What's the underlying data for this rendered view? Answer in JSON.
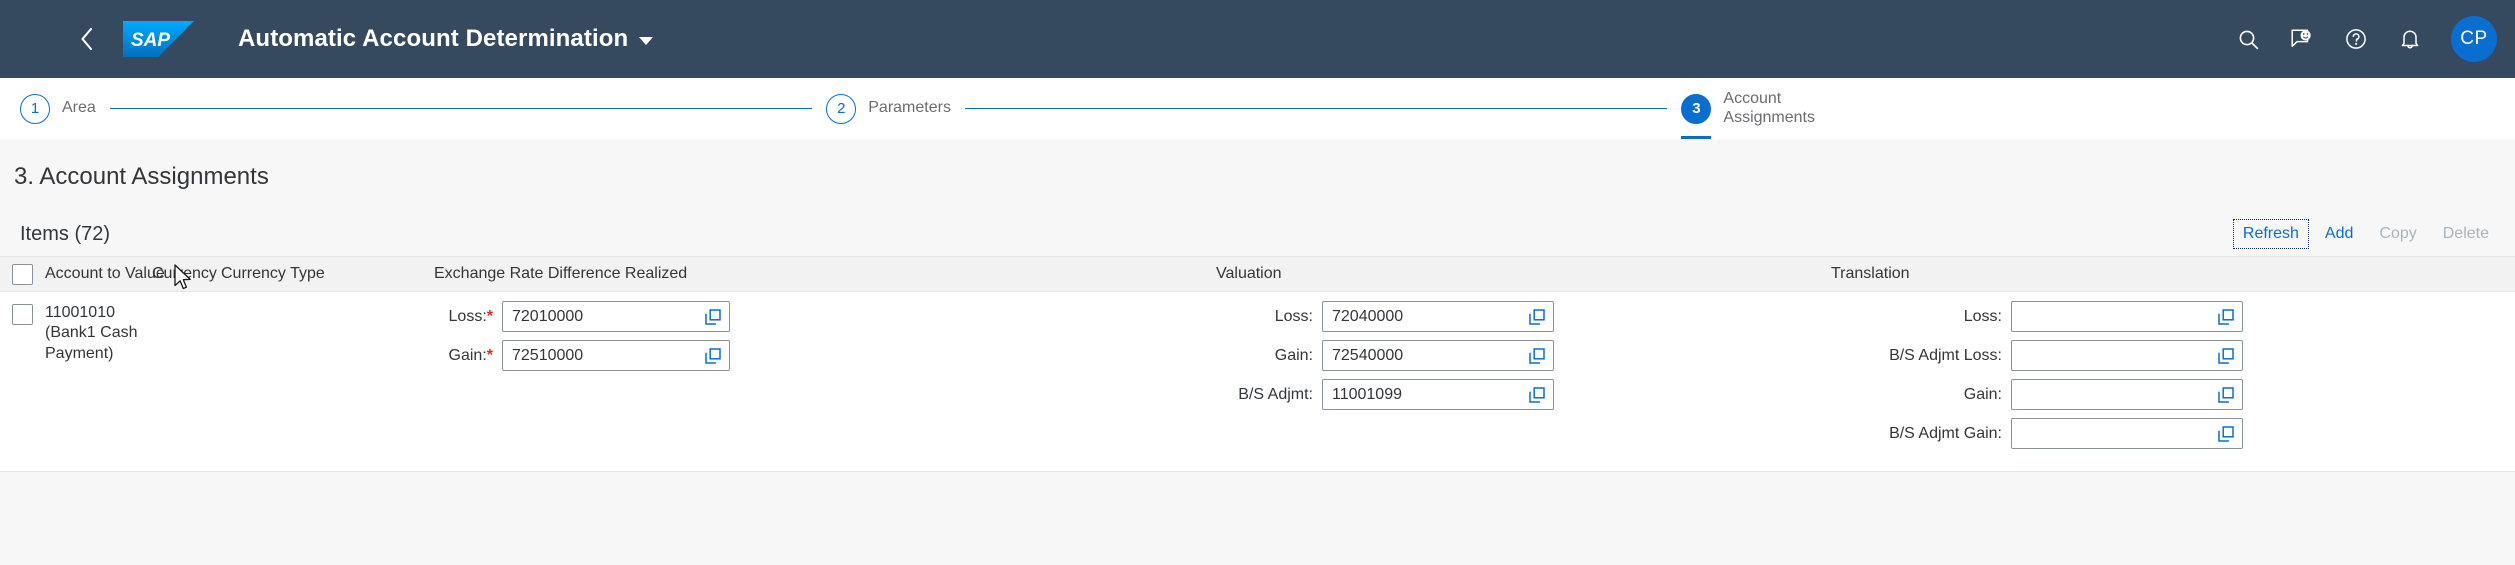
{
  "shell": {
    "back_icon": "chevron-left-icon",
    "logo_text": "SAP",
    "title": "Automatic Account Determination",
    "icons": [
      "search-icon",
      "feedback-icon",
      "help-icon",
      "notifications-icon"
    ],
    "avatar_initials": "CP"
  },
  "wizard": {
    "steps": [
      {
        "number": "1",
        "label": "Area",
        "state": "completed"
      },
      {
        "number": "2",
        "label": "Parameters",
        "state": "completed"
      },
      {
        "number": "3",
        "label": "Account\nAssignments",
        "state": "active"
      }
    ]
  },
  "page": {
    "title": "3. Account Assignments",
    "items_title": "Items (72)",
    "toolbar": [
      {
        "label": "Refresh",
        "enabled": true,
        "focused": true
      },
      {
        "label": "Add",
        "enabled": true,
        "focused": false
      },
      {
        "label": "Copy",
        "enabled": false,
        "focused": false
      },
      {
        "label": "Delete",
        "enabled": false,
        "focused": false
      }
    ]
  },
  "table": {
    "headers": {
      "account_to_value": "Account to Value",
      "currency": "Currency",
      "currency_type": "Currency Type",
      "exchange_rate_difference_realized": "Exchange Rate Difference Realized",
      "valuation": "Valuation",
      "translation": "Translation"
    },
    "row": {
      "account_to_value": "11001010 (Bank1 Cash Payment)",
      "currency": "",
      "currency_type": "",
      "exchange_rate_difference_realized": [
        {
          "label": "Loss:",
          "required": true,
          "value": "72010000",
          "placeholder": ""
        },
        {
          "label": "Gain:",
          "required": true,
          "value": "72510000",
          "placeholder": ""
        }
      ],
      "valuation": [
        {
          "label": "Loss:",
          "required": false,
          "value": "72040000",
          "placeholder": ""
        },
        {
          "label": "Gain:",
          "required": false,
          "value": "72540000",
          "placeholder": ""
        },
        {
          "label": "B/S Adjmt:",
          "required": false,
          "value": "11001099",
          "placeholder": ""
        }
      ],
      "translation": [
        {
          "label": "Loss:",
          "required": false,
          "value": "",
          "placeholder": ""
        },
        {
          "label": "B/S Adjmt Loss:",
          "required": false,
          "value": "",
          "placeholder": ""
        },
        {
          "label": "Gain:",
          "required": false,
          "value": "",
          "placeholder": ""
        },
        {
          "label": "B/S Adjmt Gain:",
          "required": false,
          "value": "",
          "placeholder": ""
        }
      ]
    }
  },
  "colors": {
    "shell_bg": "#354a5f",
    "accent": "#0a6ed1",
    "required": "#e02a28",
    "page_bg": "#f7f7f7",
    "disabled_text": "#a9b4be"
  }
}
